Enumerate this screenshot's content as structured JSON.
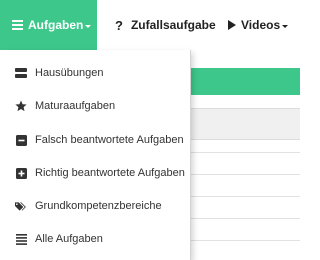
{
  "navbar": {
    "items": [
      {
        "label": "Aufgaben",
        "icon": "list-icon",
        "active": true,
        "dropdown": true
      },
      {
        "label": "Zufallsaufgabe",
        "icon": "question-icon",
        "active": false,
        "dropdown": false
      },
      {
        "label": "Videos",
        "icon": "play-icon",
        "active": false,
        "dropdown": true
      }
    ],
    "question_glyph": "?"
  },
  "dropdown": {
    "items": [
      {
        "label": "Hausübungen",
        "icon": "hdd-icon"
      },
      {
        "label": "Maturaaufgaben",
        "icon": "star-icon"
      },
      {
        "label": "Falsch beantwortete Aufgaben",
        "icon": "minus-square-icon"
      },
      {
        "label": "Richtig beantwortete Aufgaben",
        "icon": "plus-square-icon"
      },
      {
        "label": "Grundkompetenzbereiche",
        "icon": "tags-icon"
      },
      {
        "label": "Alle Aufgaben",
        "icon": "list-icon"
      }
    ]
  },
  "colors": {
    "accent": "#3dc78b",
    "text": "#333333",
    "nav_text": "#222222"
  }
}
